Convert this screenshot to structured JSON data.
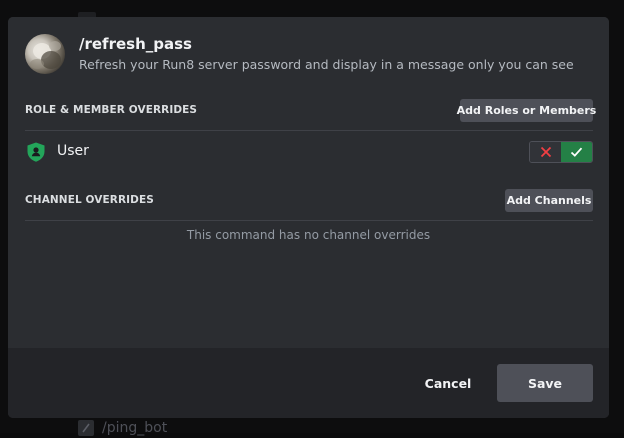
{
  "background": {
    "hidden_row_label": "/ping_bot"
  },
  "modal": {
    "command": {
      "name": "/refresh_pass",
      "description": "Refresh your Run8 server password and display in a message only you can see"
    },
    "role_section": {
      "title": "ROLE & MEMBER OVERRIDES",
      "add_button": "Add Roles or Members",
      "overrides": [
        {
          "name": "User",
          "icon": "shield-user-icon",
          "state": "allow"
        }
      ]
    },
    "channel_section": {
      "title": "CHANNEL OVERRIDES",
      "add_button": "Add Channels",
      "empty_message": "This command has no channel overrides"
    },
    "footer": {
      "cancel_label": "Cancel",
      "save_label": "Save"
    }
  },
  "colors": {
    "accent_allow": "#248046",
    "deny_icon": "#f23f43",
    "role_icon": "#23a55a"
  }
}
